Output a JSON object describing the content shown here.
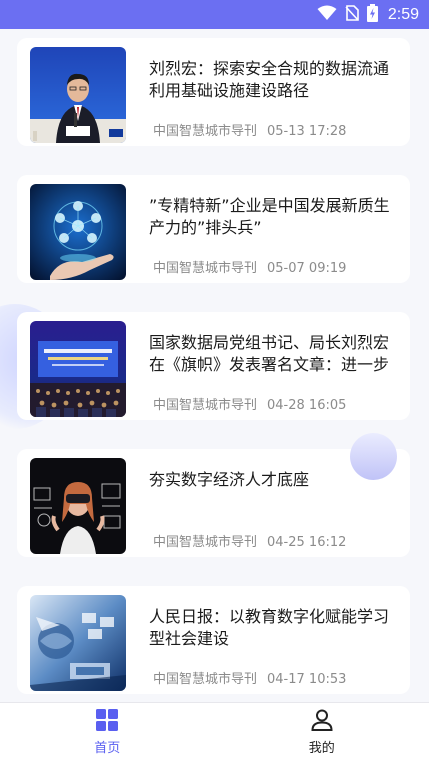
{
  "status_bar": {
    "time": "2:59",
    "icons": [
      "wifi-icon",
      "no-sim-icon",
      "battery-charging-icon"
    ]
  },
  "articles": [
    {
      "title": "刘烈宏：探索安全合规的数据流通利用基础设施建设路径",
      "source": "中国智慧城市导刊",
      "date": "05-13 17:28",
      "image": "speaker-at-press-podium"
    },
    {
      "title": "”专精特新”企业是中国发展新质生产力的”排头兵”",
      "source": "中国智慧城市导刊",
      "date": "05-07 09:19",
      "image": "network-globe-hand"
    },
    {
      "title": "国家数据局党组书记、局长刘烈宏在《旗帜》发表署名文章：进一步",
      "source": "中国智慧城市导刊",
      "date": "04-28 16:05",
      "image": "conference-stage"
    },
    {
      "title": "夯实数字经济人才底座",
      "source": "中国智慧城市导刊",
      "date": "04-25 16:12",
      "image": "woman-with-vr-headset"
    },
    {
      "title": "人民日报：以教育数字化赋能学习型社会建设",
      "source": "中国智慧城市导刊",
      "date": "04-17 10:53",
      "image": "digital-education-collage"
    }
  ],
  "bottom_nav": [
    {
      "label": "首页",
      "icon": "grid-icon",
      "active": true
    },
    {
      "label": "我的",
      "icon": "user-icon",
      "active": false
    }
  ],
  "colors": {
    "accent": "#6b6ff2",
    "nav_active": "#5a5ff0",
    "background": "#f6f7fb"
  }
}
